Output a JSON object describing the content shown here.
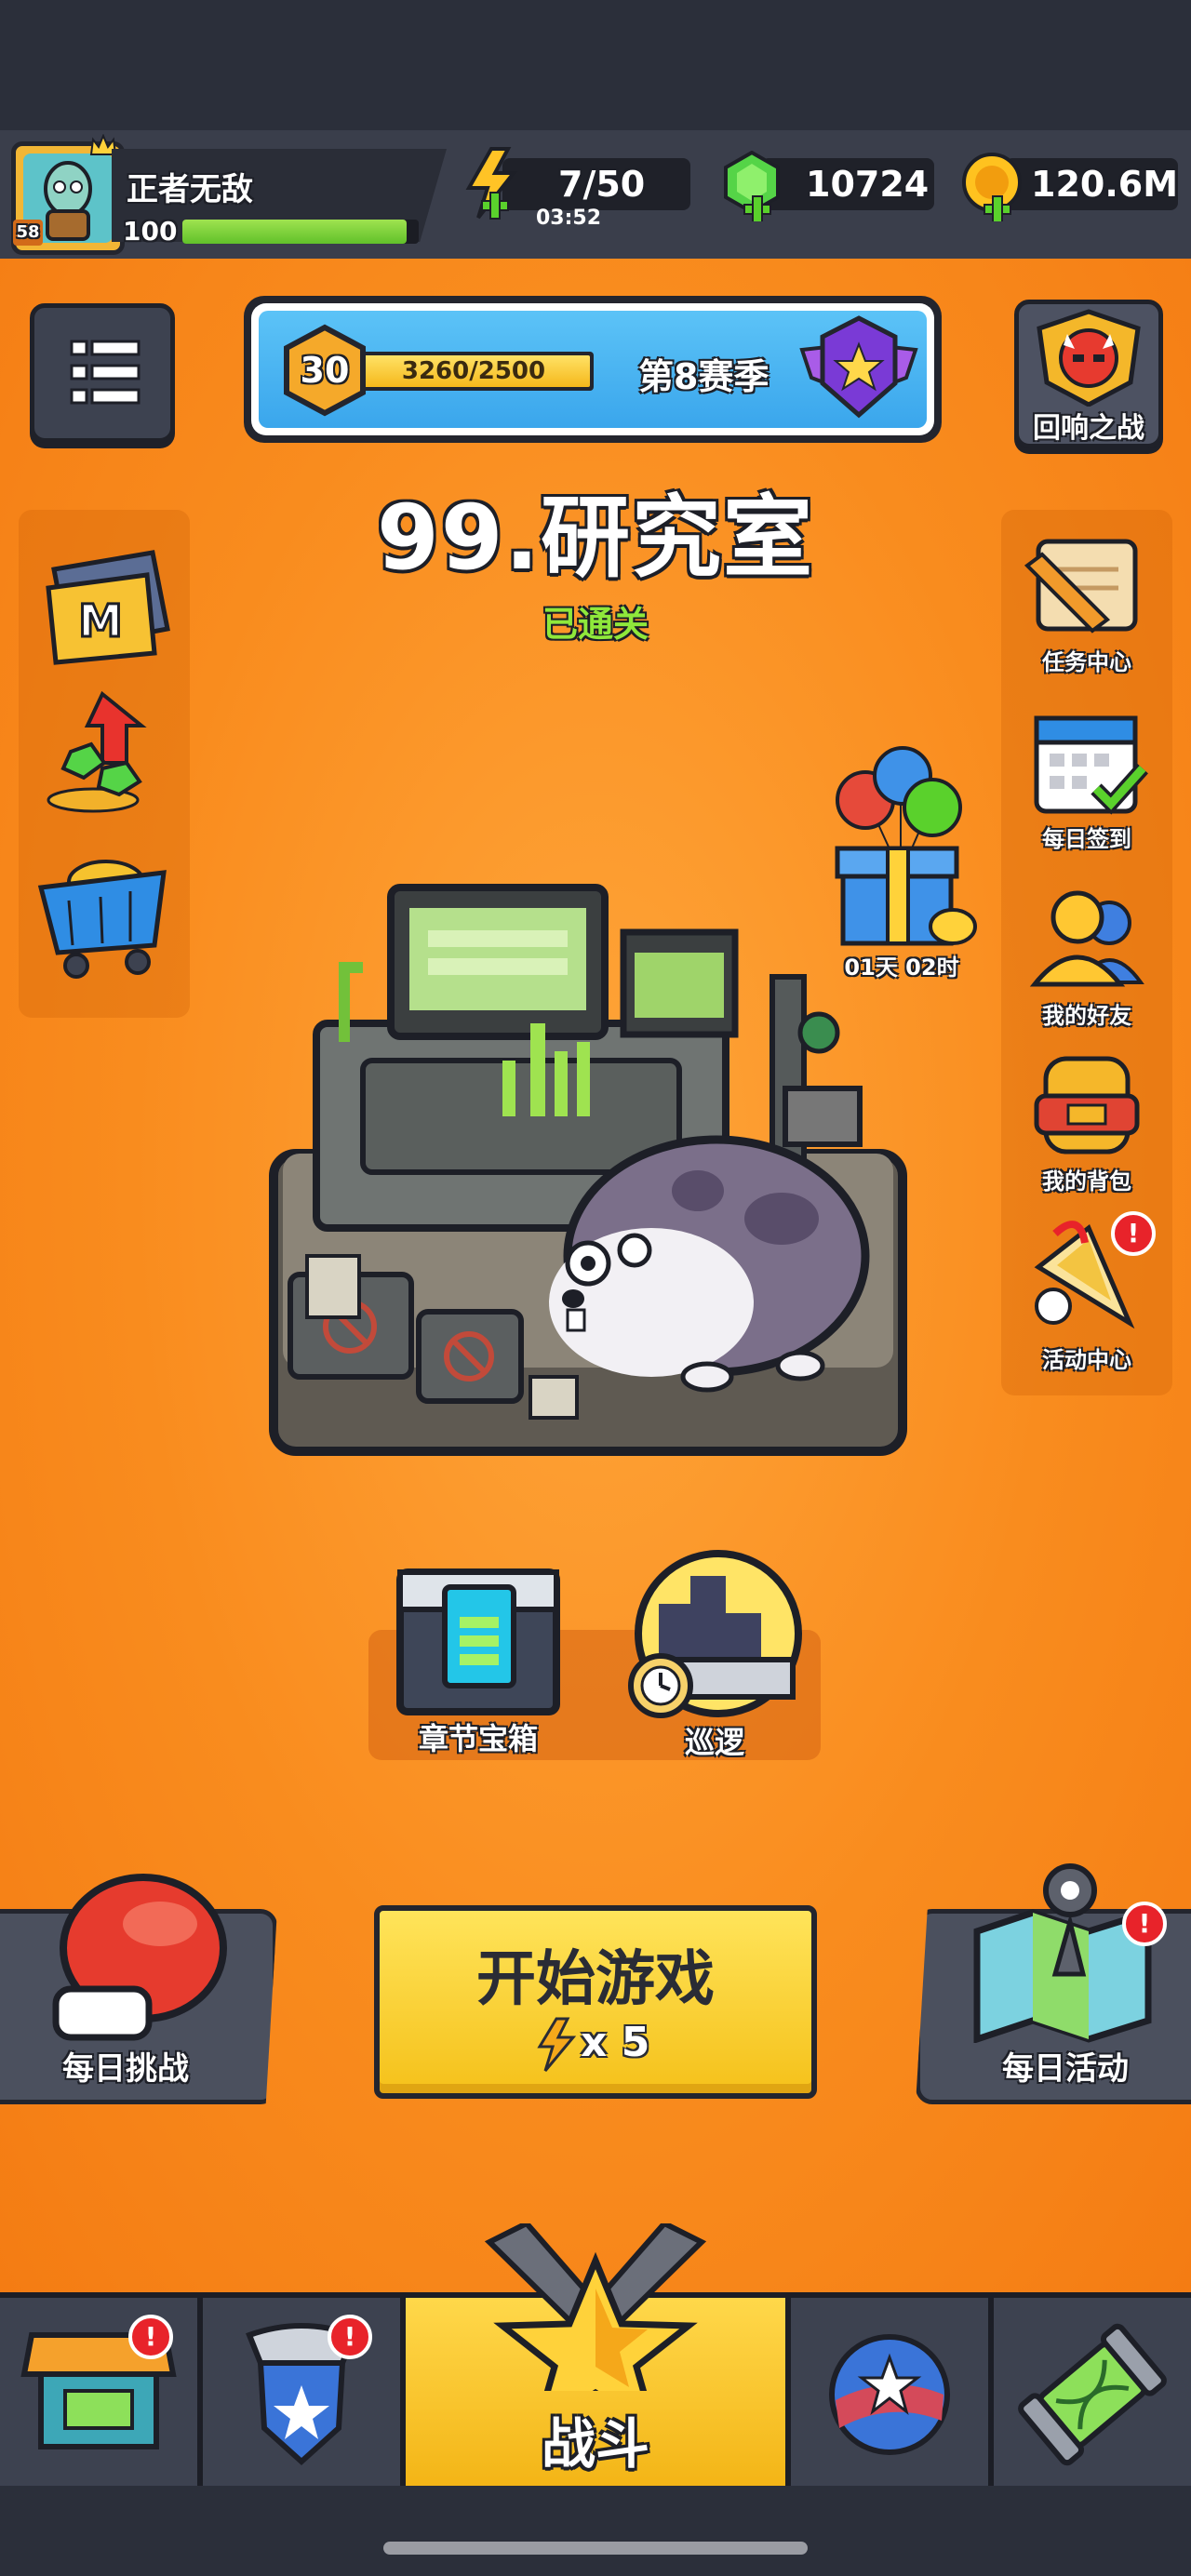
{
  "player": {
    "name": "正者无敌",
    "level": "58",
    "exp": "100",
    "exp_progress": 0.95
  },
  "resources": {
    "energy": "7/50",
    "energy_timer": "03:52",
    "gems": "10724",
    "coins": "120.6M"
  },
  "season": {
    "level": "30",
    "progress_text": "3260/2500",
    "progress": 1.0,
    "label": "第8赛季"
  },
  "echo_battle": {
    "label": "回响之战"
  },
  "stage": {
    "title": "99.研究室",
    "status": "已通关"
  },
  "right_menu": [
    {
      "label": "任务中心",
      "icon": "scroll-pencil-icon"
    },
    {
      "label": "每日签到",
      "icon": "calendar-check-icon"
    },
    {
      "label": "我的好友",
      "icon": "friends-icon"
    },
    {
      "label": "我的背包",
      "icon": "backpack-icon"
    },
    {
      "label": "活动中心",
      "icon": "party-horn-icon"
    }
  ],
  "gift": {
    "timer": "01天 02时"
  },
  "chapter_chest": {
    "label": "章节宝箱"
  },
  "patrol": {
    "label": "巡逻"
  },
  "daily_challenge": {
    "label": "每日挑战"
  },
  "start_game": {
    "label": "开始游戏",
    "cost": "x 5"
  },
  "daily_events": {
    "label": "每日活动"
  },
  "nav": {
    "battle_label": "战斗"
  },
  "colors": {
    "orange_bg": "#f98c1e",
    "yellow_button": "#f5c11a",
    "dark_frame": "#23252e",
    "badge_red": "#e8232a"
  }
}
